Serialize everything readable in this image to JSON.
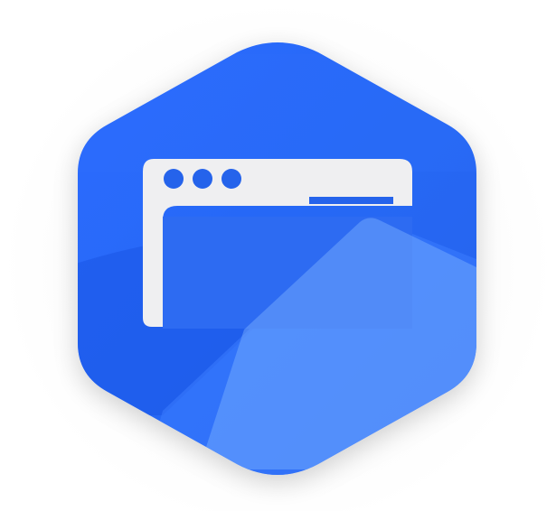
{
  "icon": {
    "name": "browser-window-hexagon-icon",
    "colors": {
      "hexagon_dark": "#1d5ce8",
      "hexagon_light": "#2f74ff",
      "highlight": "#6aa6ff",
      "window_frame": "#efeff1",
      "window_dots": "#2563eb",
      "address_bar": "#2563eb",
      "content_area": "#2f6df0"
    },
    "window_dot_count": 3
  }
}
